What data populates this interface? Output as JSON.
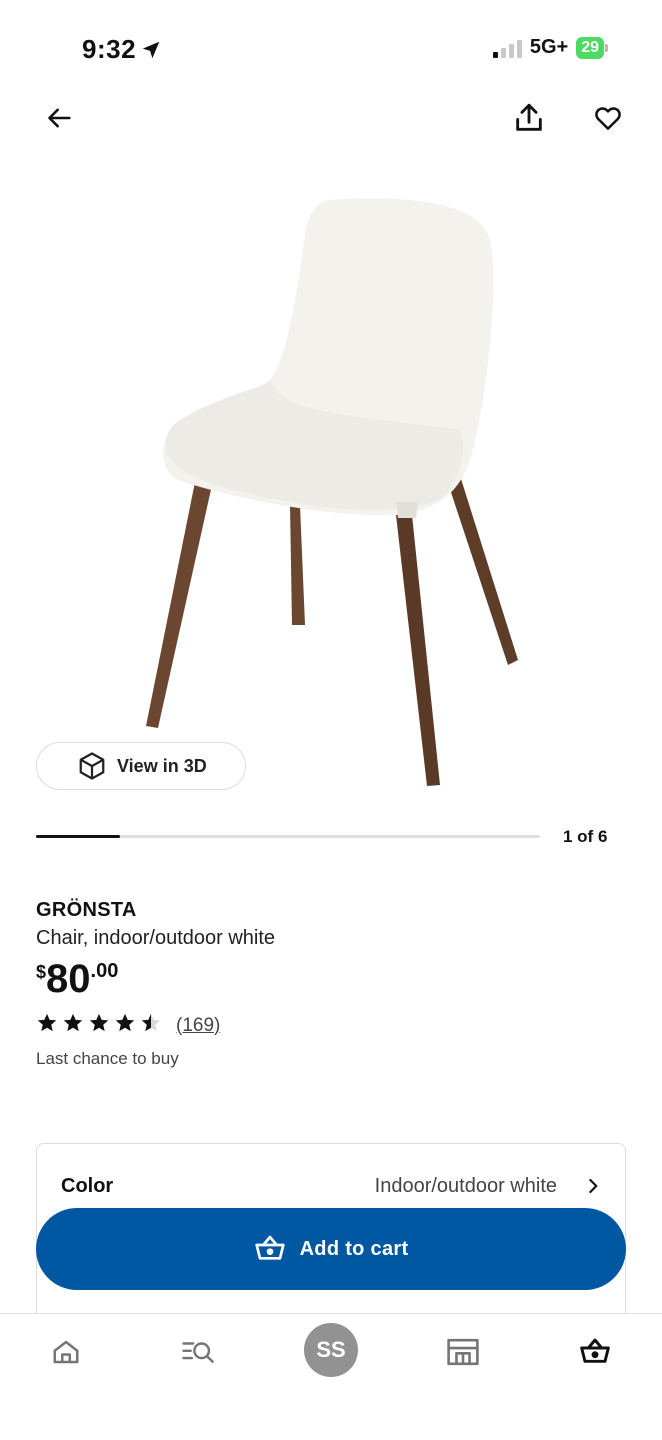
{
  "status_bar": {
    "time": "9:32",
    "network": "5G+",
    "battery": "29"
  },
  "top_nav": {
    "icons": [
      "back-arrow-icon",
      "share-icon",
      "heart-icon"
    ]
  },
  "gallery": {
    "view_3d_label": "View in 3D",
    "counter": "1 of 6",
    "current": 1,
    "total": 6
  },
  "product": {
    "name": "GRÖNSTA",
    "description": "Chair, indoor/outdoor white",
    "price_currency": "$",
    "price_main": "80",
    "price_cents": ".00",
    "rating": 4.5,
    "review_count": "(169)",
    "availability": "Last chance to buy"
  },
  "options": {
    "color_label": "Color",
    "color_value": "Indoor/outdoor white"
  },
  "cta": {
    "add_to_cart": "Add to cart",
    "color": "#0058a3"
  },
  "tab_bar": {
    "profile_initials": "SS",
    "icons": [
      "home-icon",
      "search-icon",
      "avatar",
      "store-icon",
      "cart-icon"
    ]
  }
}
